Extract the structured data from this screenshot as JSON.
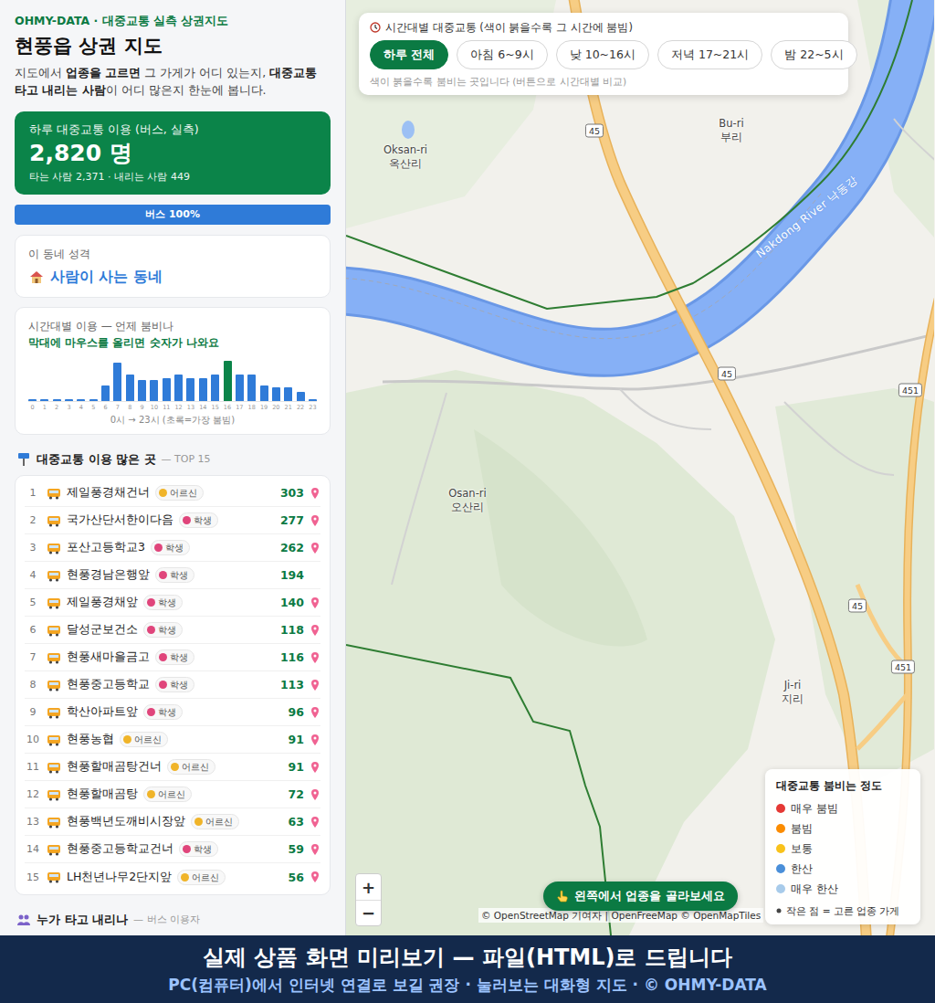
{
  "sidebar": {
    "brand": "OHMY-DATA · 대중교통 실측 상권지도",
    "title": "현풍읍 상권 지도",
    "intro": [
      {
        "text": "지도에서 ",
        "bold": false
      },
      {
        "text": "업종을 고르면",
        "bold": true
      },
      {
        "text": " 그 가게가 어디 있는지, ",
        "bold": false
      },
      {
        "text": "대중교통 타고 내리는 사람",
        "bold": true
      },
      {
        "text": "이 어디 많은지 한눈에 봅니다.",
        "bold": false
      }
    ],
    "summary": {
      "label": "하루 대중교통 이용 (버스, 실측)",
      "value": "2,820 명",
      "detail": "타는 사람 2,371 · 내리는 사람 449"
    },
    "mode_bar": {
      "label": "버스 100%",
      "level": 1
    },
    "character": {
      "label": "이 동네 성격",
      "value": "사람이 사는 동네"
    },
    "hourly": {
      "title": "시간대별 이용 — 언제 붐비나",
      "hint": "막대에 마우스를 올리면 숫자가 나와요",
      "values": [
        5,
        5,
        5,
        5,
        5,
        5,
        110,
        275,
        190,
        150,
        150,
        165,
        190,
        165,
        165,
        190,
        285,
        190,
        190,
        110,
        95,
        95,
        65,
        10
      ],
      "ticks": [
        "0",
        "1",
        "2",
        "3",
        "4",
        "5",
        "6",
        "7",
        "8",
        "9",
        "10",
        "11",
        "12",
        "13",
        "14",
        "15",
        "16",
        "17",
        "18",
        "19",
        "20",
        "21",
        "22",
        "23"
      ],
      "peak_index": 16,
      "caption": "0시 → 23시 (초록=가장 붐빔)"
    },
    "top_list": {
      "title": "대중교통 이용 많은 곳",
      "sub": "— TOP 15",
      "rows": [
        {
          "rank": "1",
          "name": "제일풍경채건너",
          "tag": "어르신",
          "color": "#f0b429",
          "count": "303",
          "pinned": true
        },
        {
          "rank": "2",
          "name": "국가산단서한이다음",
          "tag": "학생",
          "color": "#e0457b",
          "count": "277",
          "pinned": true
        },
        {
          "rank": "3",
          "name": "포산고등학교3",
          "tag": "학생",
          "color": "#e0457b",
          "count": "262",
          "pinned": true
        },
        {
          "rank": "4",
          "name": "현풍경남은행앞",
          "tag": "학생",
          "color": "#e0457b",
          "count": "194",
          "pinned": false
        },
        {
          "rank": "5",
          "name": "제일풍경채앞",
          "tag": "학생",
          "color": "#e0457b",
          "count": "140",
          "pinned": true
        },
        {
          "rank": "6",
          "name": "달성군보건소",
          "tag": "학생",
          "color": "#e0457b",
          "count": "118",
          "pinned": true
        },
        {
          "rank": "7",
          "name": "현풍새마을금고",
          "tag": "학생",
          "color": "#e0457b",
          "count": "116",
          "pinned": true
        },
        {
          "rank": "8",
          "name": "현풍중고등학교",
          "tag": "학생",
          "color": "#e0457b",
          "count": "113",
          "pinned": true
        },
        {
          "rank": "9",
          "name": "학산아파트앞",
          "tag": "학생",
          "color": "#e0457b",
          "count": "96",
          "pinned": true
        },
        {
          "rank": "10",
          "name": "현풍농협",
          "tag": "어르신",
          "color": "#f0b429",
          "count": "91",
          "pinned": true
        },
        {
          "rank": "11",
          "name": "현풍할매곰탕건너",
          "tag": "어르신",
          "color": "#f0b429",
          "count": "91",
          "pinned": true
        },
        {
          "rank": "12",
          "name": "현풍할매곰탕",
          "tag": "어르신",
          "color": "#f0b429",
          "count": "72",
          "pinned": true
        },
        {
          "rank": "13",
          "name": "현풍백년도깨비시장앞",
          "tag": "어르신",
          "color": "#f0b429",
          "count": "63",
          "pinned": true
        },
        {
          "rank": "14",
          "name": "현풍중고등학교건너",
          "tag": "학생",
          "color": "#e0457b",
          "count": "59",
          "pinned": true
        },
        {
          "rank": "15",
          "name": "LH천년나무2단지앞",
          "tag": "어르신",
          "color": "#f0b429",
          "count": "56",
          "pinned": true
        }
      ]
    },
    "riders": {
      "title": "누가 타고 내리나",
      "sub": "— 버스 이용자"
    }
  },
  "map": {
    "time_panel": {
      "title": "시간대별 대중교통 (색이 붉을수록 그 시간에 붐빔)",
      "buttons": [
        {
          "label": "하루 전체",
          "selected": true
        },
        {
          "label": "아침 6~9시",
          "selected": false
        },
        {
          "label": "낮 10~16시",
          "selected": false
        },
        {
          "label": "저녁 17~21시",
          "selected": false
        },
        {
          "label": "밤 22~5시",
          "selected": false
        }
      ],
      "note": "색이 붉을수록 붐비는 곳입니다 (버튼으로 시간대별 비교)"
    },
    "places": [
      {
        "en": "Oksan-ri",
        "ko": "옥산리"
      },
      {
        "en": "Bu-ri",
        "ko": "부리"
      },
      {
        "en": "Osan-ri",
        "ko": "오산리"
      },
      {
        "en": "Ji-ri",
        "ko": "지리"
      }
    ],
    "river_label": "Nakdong River 낙동강",
    "road_shields": [
      "45",
      "45",
      "451",
      "45",
      "451"
    ],
    "legend": {
      "title": "대중교통 붐비는 정도",
      "items": [
        {
          "label": "매우 붐빔",
          "color": "#e53935"
        },
        {
          "label": "붐빔",
          "color": "#fb8c00"
        },
        {
          "label": "보통",
          "color": "#f9c21b"
        },
        {
          "label": "한산",
          "color": "#4a8fd9"
        },
        {
          "label": "매우 한산",
          "color": "#a8cbea"
        }
      ],
      "note": "작은 점 = 고른 업종 가게"
    },
    "zoom": [
      "+",
      "−"
    ],
    "hint_button": "왼쪽에서 업종을 골라보세요",
    "attribution": "© OpenStreetMap 기여자 | OpenFreeMap © OpenMapTiles"
  },
  "banner": {
    "title": "실제 상품 화면 미리보기 — 파일(HTML)로 드립니다",
    "subtitle": "PC(컴퓨터)에서 인터넷 연결로 보길 권장 · 눌러보는 대화형 지도 · © OHMY-DATA"
  }
}
